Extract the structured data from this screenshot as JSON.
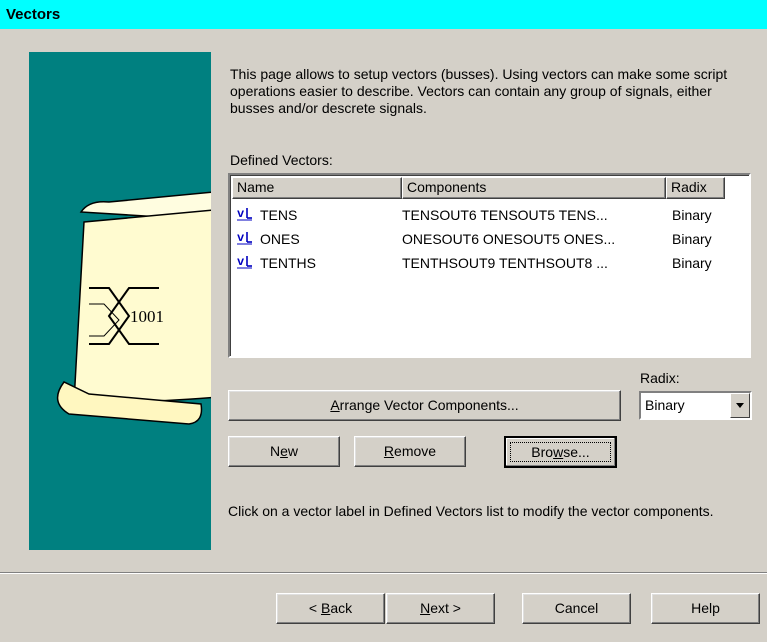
{
  "window": {
    "title": "Vectors"
  },
  "banner": {
    "logo_text": "1001"
  },
  "intro": {
    "text": "This page allows to setup vectors (busses). Using vectors can make some script operations easier to describe. Vectors can contain any group of signals, either busses and/or descrete signals."
  },
  "defined_vectors": {
    "label": "Defined Vectors:",
    "columns": [
      "Name",
      "Components",
      "Radix"
    ],
    "rows": [
      {
        "icon": "vector-icon",
        "name": "TENS",
        "components": "TENSOUT6 TENSOUT5 TENS...",
        "radix": "Binary"
      },
      {
        "icon": "vector-icon",
        "name": "ONES",
        "components": "ONESOUT6 ONESOUT5 ONES...",
        "radix": "Binary"
      },
      {
        "icon": "vector-icon",
        "name": "TENTHS",
        "components": "TENTHSOUT9 TENTHSOUT8 ...",
        "radix": "Binary"
      }
    ]
  },
  "radix": {
    "label": "Radix:",
    "value": "Binary"
  },
  "buttons": {
    "arrange": {
      "accel": "A",
      "rest": "rrange Vector Components..."
    },
    "new": {
      "pre": "N",
      "accel": "e",
      "rest": "w"
    },
    "remove": {
      "accel": "R",
      "rest": "emove"
    },
    "browse": {
      "pre": "Bro",
      "accel": "w",
      "rest": "se..."
    }
  },
  "hint": {
    "text": "Click on a vector label in Defined Vectors list to modify the vector components."
  },
  "wizard": {
    "back": {
      "pre": "< ",
      "accel": "B",
      "rest": "ack"
    },
    "next": {
      "accel": "N",
      "rest": "ext >"
    },
    "cancel": "Cancel",
    "help": "Help"
  }
}
